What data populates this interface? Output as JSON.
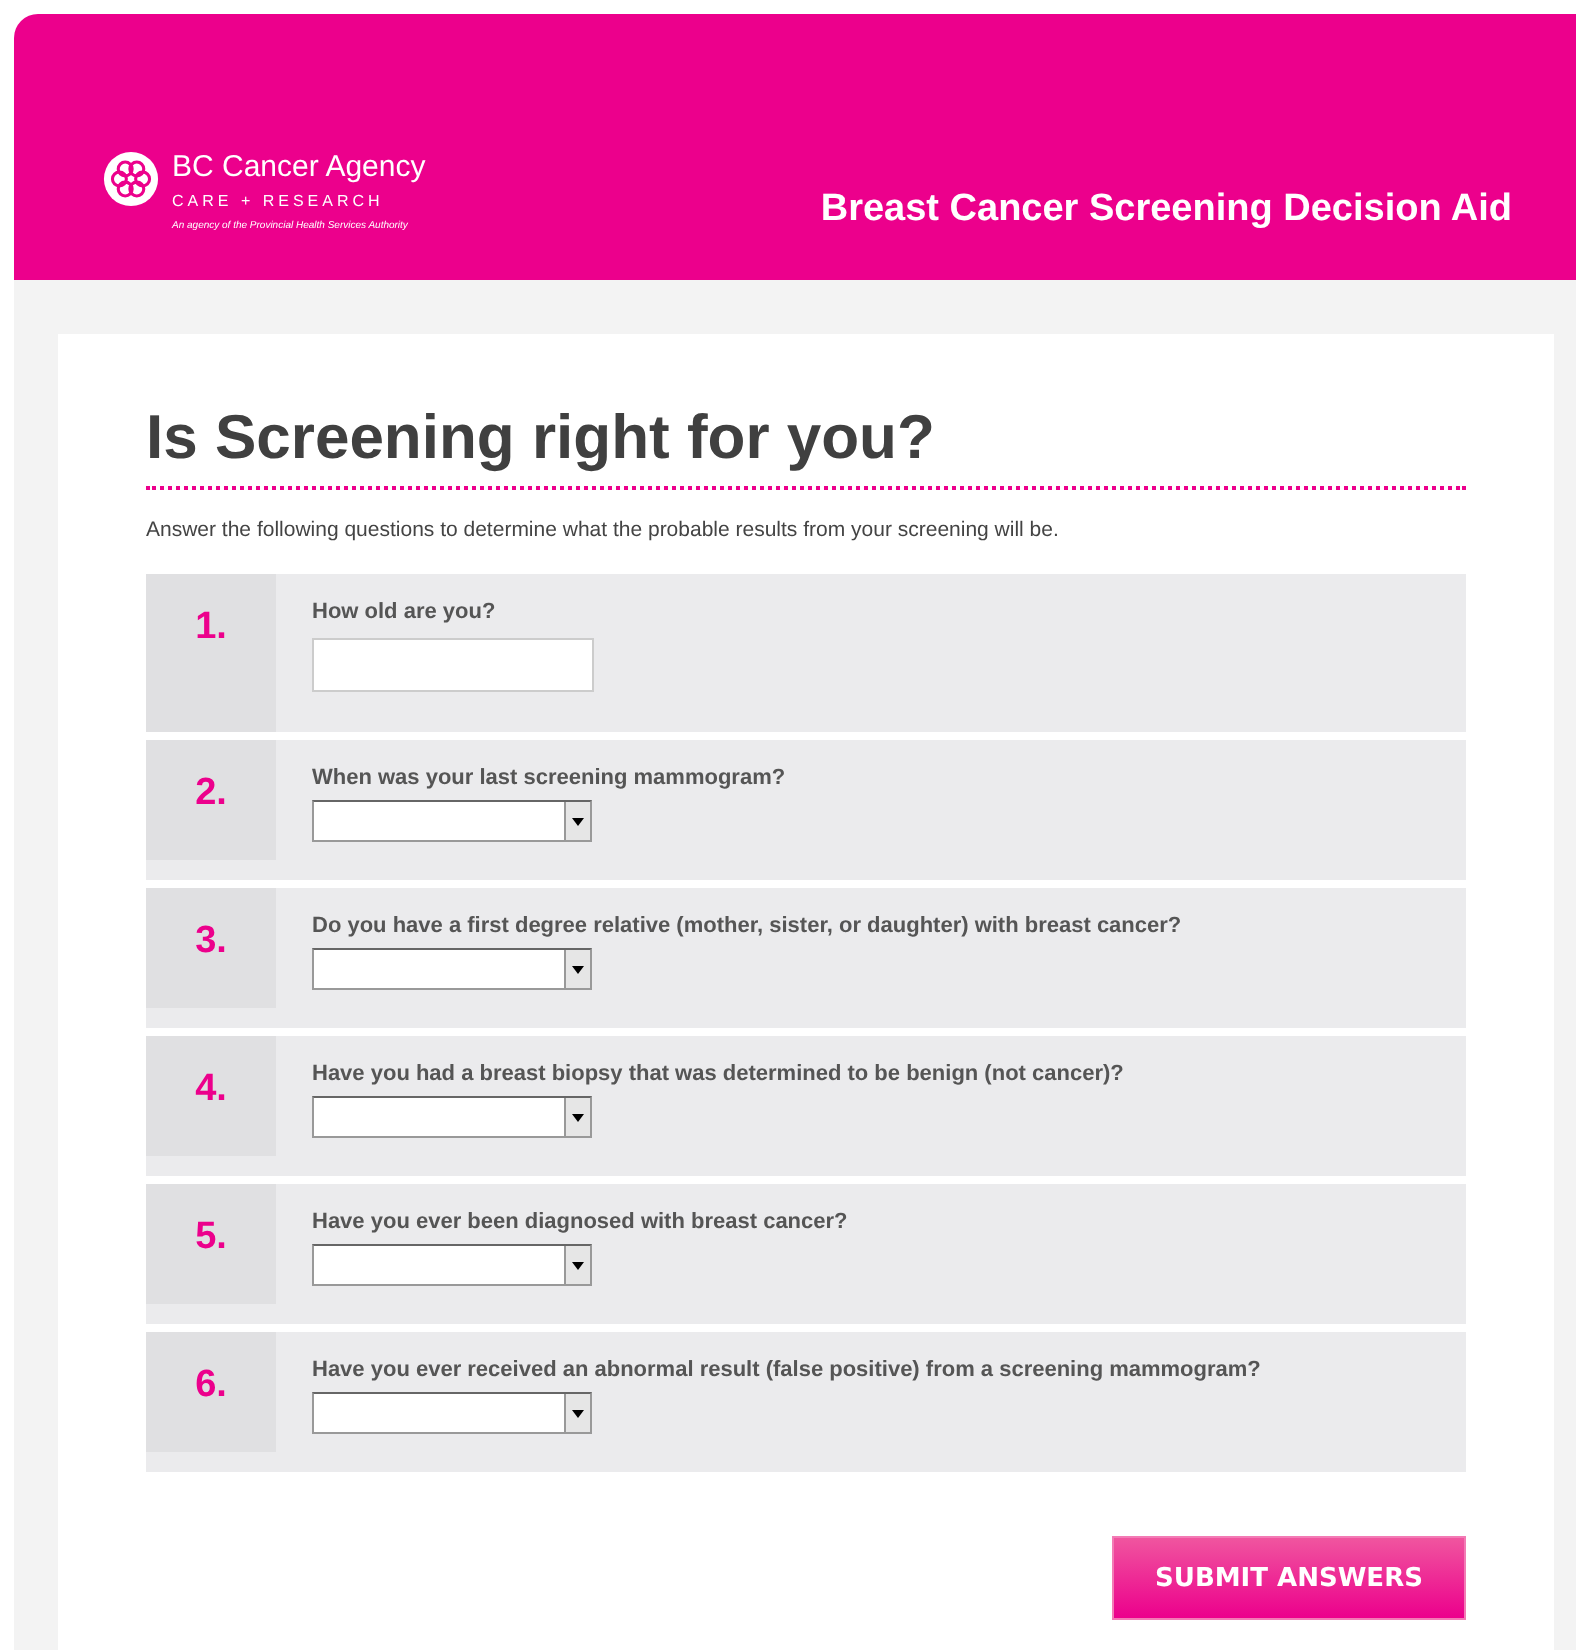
{
  "header": {
    "logo": {
      "name": "BC Cancer Agency",
      "tagline": "CARE + RESEARCH",
      "subline": "An agency of the Provincial Health Services Authority"
    },
    "title": "Breast Cancer Screening Decision Aid"
  },
  "page": {
    "heading": "Is Screening right for you?",
    "intro": "Answer the following questions to determine what the probable results from your screening will be."
  },
  "questions": [
    {
      "number": "1.",
      "label": "How old are you?",
      "kind": "text"
    },
    {
      "number": "2.",
      "label": "When was your last screening mammogram?",
      "kind": "select"
    },
    {
      "number": "3.",
      "label": "Do you have a first degree relative (mother, sister, or daughter) with breast cancer?",
      "kind": "select"
    },
    {
      "number": "4.",
      "label": "Have you had a breast biopsy that was determined to be benign (not cancer)?",
      "kind": "select"
    },
    {
      "number": "5.",
      "label": "Have you ever been diagnosed with breast cancer?",
      "kind": "select"
    },
    {
      "number": "6.",
      "label": "Have you ever received an abnormal result (false positive) from a screening mammogram?",
      "kind": "select"
    }
  ],
  "submit": "SUBMIT ANSWERS"
}
